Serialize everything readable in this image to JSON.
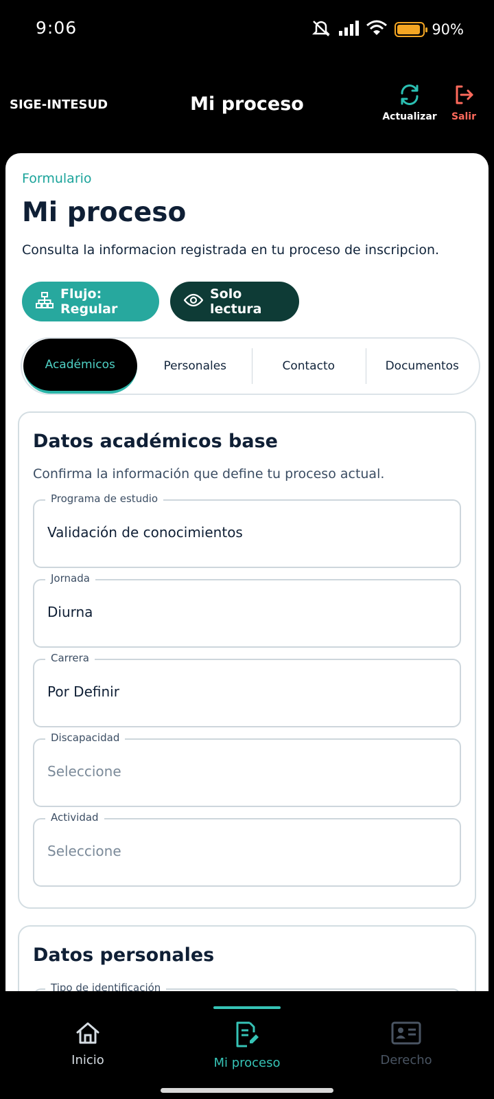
{
  "status_bar": {
    "time": "9:06",
    "battery_text": "90%",
    "battery_level": 0.9,
    "icons": [
      "mute-icon",
      "signal-icon",
      "wifi-icon",
      "battery-icon"
    ]
  },
  "header": {
    "brand": "SIGE-INTESUD",
    "title": "Mi proceso",
    "refresh_label": "Actualizar",
    "exit_label": "Salir"
  },
  "page": {
    "eyebrow": "Formulario",
    "title": "Mi proceso",
    "subtitle": "Consulta la informacion registrada en tu proceso de inscripcion.",
    "flow_pill": "Flujo: Regular",
    "readonly_pill": "Solo lectura"
  },
  "tabs": [
    {
      "label": "Académicos",
      "active": true
    },
    {
      "label": "Personales",
      "active": false
    },
    {
      "label": "Contacto",
      "active": false
    },
    {
      "label": "Documentos",
      "active": false
    }
  ],
  "academic_section": {
    "title": "Datos académicos base",
    "description": "Confirma la información que define tu proceso actual.",
    "fields": [
      {
        "label": "Programa de estudio",
        "value": "Validación de conocimientos",
        "placeholder": false
      },
      {
        "label": "Jornada",
        "value": "Diurna",
        "placeholder": false
      },
      {
        "label": "Carrera",
        "value": "Por Definir",
        "placeholder": false
      },
      {
        "label": "Discapacidad",
        "value": "Seleccione",
        "placeholder": true
      },
      {
        "label": "Actividad",
        "value": "Seleccione",
        "placeholder": true
      }
    ]
  },
  "personal_section": {
    "title": "Datos personales",
    "fields": [
      {
        "label": "Tipo de identificación"
      }
    ]
  },
  "bottom_nav": {
    "items": [
      {
        "label": "Inicio",
        "icon": "home-icon"
      },
      {
        "label": "Mi proceso",
        "icon": "document-edit-icon"
      },
      {
        "label": "Derecho",
        "icon": "id-card-icon"
      }
    ]
  },
  "colors": {
    "accent": "#27a89e",
    "dark_accent": "#0e3b36",
    "exit": "#ff6a5c",
    "battery": "#f5a623"
  }
}
